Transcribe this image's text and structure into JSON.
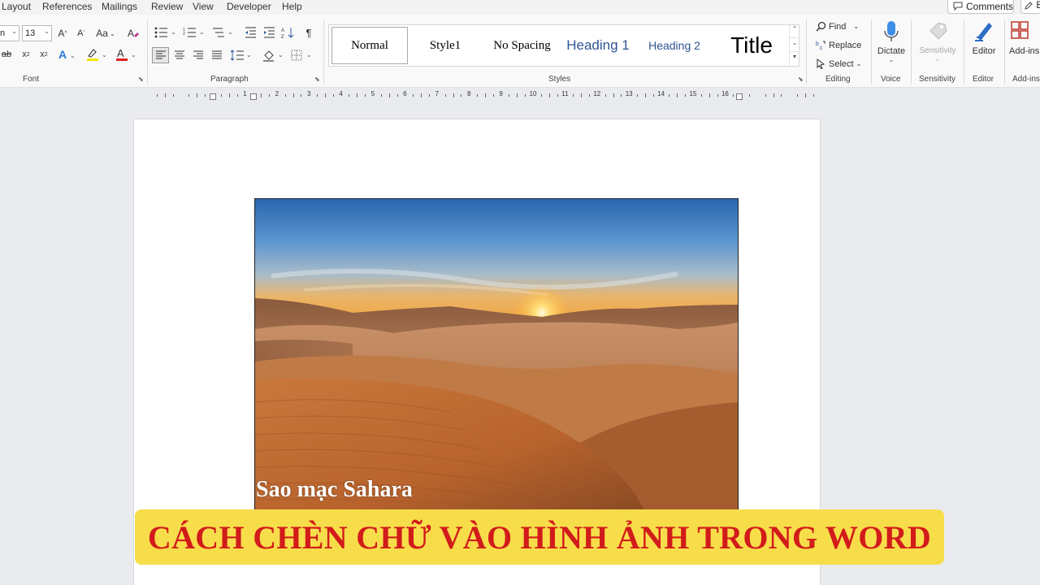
{
  "menu": {
    "tabs": [
      "Layout",
      "References",
      "Mailings",
      "Review",
      "View",
      "Developer",
      "Help"
    ],
    "comments_label": "Comments",
    "edit_label": "E"
  },
  "ribbon": {
    "font": {
      "font_name_value": "n",
      "font_size_value": "13",
      "grow_icon": "A^",
      "shrink_icon": "A˅",
      "case_label": "Aa",
      "group_label": "Font"
    },
    "paragraph": {
      "group_label": "Paragraph"
    },
    "styles": {
      "items": [
        "Normal",
        "Style1",
        "No Spacing",
        "Heading 1",
        "Heading 2",
        "Title"
      ],
      "group_label": "Styles"
    },
    "editing": {
      "find_label": "Find",
      "replace_label": "Replace",
      "select_label": "Select",
      "group_label": "Editing"
    },
    "voice": {
      "dictate_label": "Dictate",
      "group_label": "Voice"
    },
    "sensitivity": {
      "button_label": "Sensitivity",
      "group_label": "Sensitivity"
    },
    "editor": {
      "button_label": "Editor",
      "group_label": "Editor"
    },
    "addins": {
      "button_label": "Add-ins",
      "group_label": "Add-ins"
    }
  },
  "ruler": {
    "numbers": [
      "1",
      "2",
      "3",
      "4",
      "5",
      "6",
      "7",
      "8",
      "9",
      "10",
      "11",
      "12",
      "13",
      "14",
      "15",
      "16"
    ]
  },
  "document": {
    "image_caption": "Sao mạc Sahara",
    "image_icon": "desert-sunset-photo"
  },
  "banner": {
    "text": "CÁCH CHÈN CHỮ VÀO HÌNH ẢNH TRONG WORD"
  },
  "colors": {
    "banner_background": "#f7dd4a",
    "banner_text": "#d21b1b",
    "heading_blue": "#2f5496",
    "accent_blue": "#2b579a"
  }
}
